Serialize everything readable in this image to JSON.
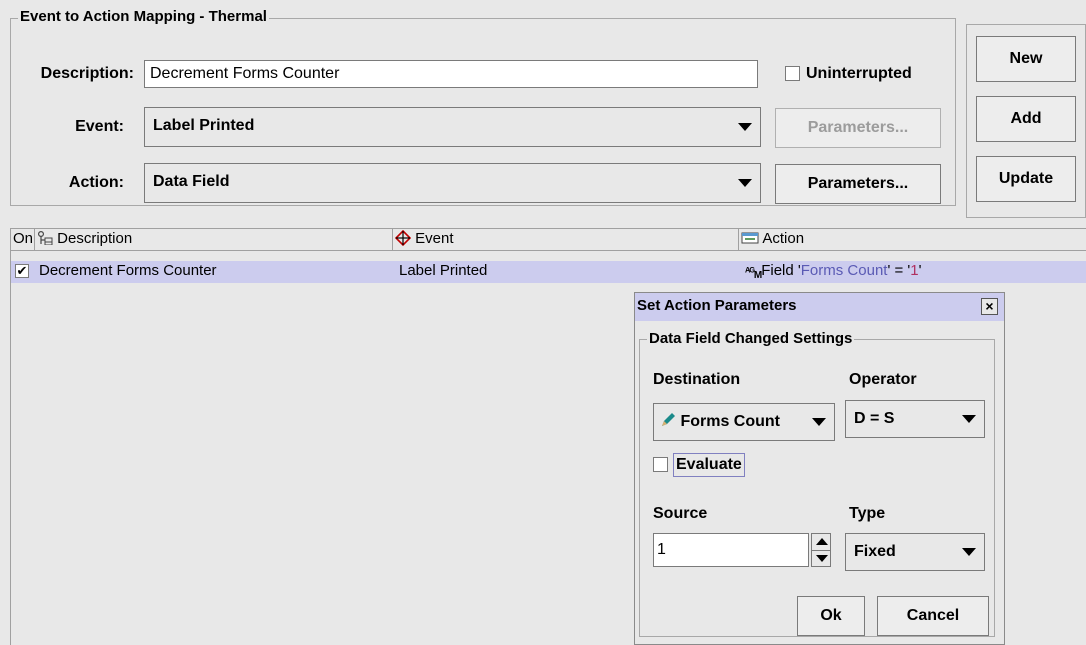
{
  "mapping": {
    "group_title": "Event to Action Mapping - Thermal",
    "description_label": "Description:",
    "description_value": "Decrement Forms Counter",
    "uninterrupted_label": "Uninterrupted",
    "event_label": "Event:",
    "event_value": "Label Printed",
    "event_params_label": "Parameters...",
    "action_label": "Action:",
    "action_value": "Data Field",
    "action_params_label": "Parameters..."
  },
  "side_buttons": {
    "new_label": "New",
    "add_label": "Add",
    "update_label": "Update"
  },
  "table": {
    "col_on": "On",
    "col_description": "Description",
    "col_event": "Event",
    "col_action": "Action",
    "rows": [
      {
        "checked": true,
        "description": "Decrement Forms Counter",
        "event": "Label Printed",
        "action_prefix": "Field '",
        "action_field": "Forms Count",
        "action_mid": "' = '",
        "action_value": "1",
        "action_suffix": "'"
      }
    ]
  },
  "dialog": {
    "title": "Set Action Parameters",
    "close_glyph": "×",
    "group_title": "Data Field Changed Settings",
    "destination_label": "Destination",
    "destination_value": "Forms Count",
    "operator_label": "Operator",
    "operator_value": "D = S",
    "evaluate_label": "Evaluate",
    "source_label": "Source",
    "source_value": "1",
    "type_label": "Type",
    "type_value": "Fixed",
    "ok_label": "Ok",
    "cancel_label": "Cancel"
  },
  "colors": {
    "selection": "#ccccee",
    "field_text": "#5a5ab4",
    "value_text": "#b03060",
    "pencil": "#1a8a8a"
  }
}
